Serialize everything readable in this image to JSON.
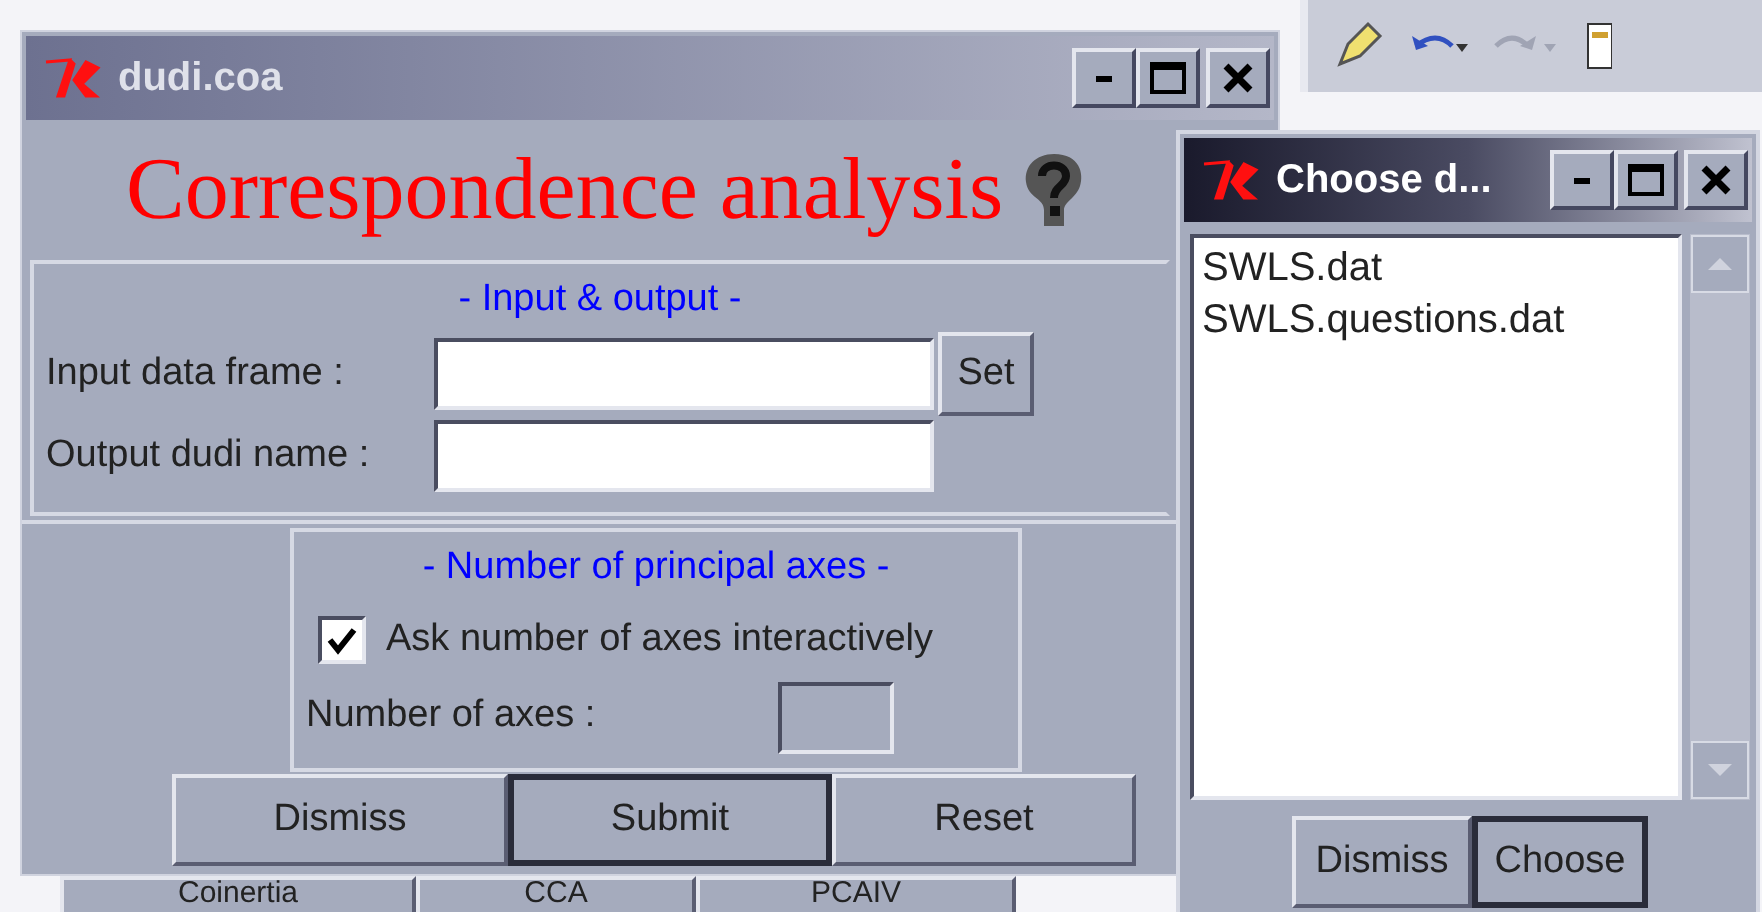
{
  "main_window": {
    "title": "dudi.coa",
    "heading": "Correspondence analysis",
    "input_output": {
      "legend": "- Input & output -",
      "fields": [
        {
          "label": "Input data frame :",
          "button": "Set"
        },
        {
          "label": "Output dudi name :"
        }
      ]
    },
    "axes": {
      "legend": "- Number of principal axes -",
      "checkbox": {
        "label": "Ask number of axes interactively",
        "checked": true
      },
      "field": {
        "label": "Number of axes :",
        "disabled": true
      }
    },
    "buttons": [
      {
        "label": "Dismiss",
        "default": false
      },
      {
        "label": "Submit",
        "default": true
      },
      {
        "label": "Reset",
        "default": false
      }
    ]
  },
  "tabs": [
    "Coinertia",
    "CCA",
    "PCAIV"
  ],
  "choose_window": {
    "title": "Choose d...",
    "items": [
      "SWLS.dat",
      "SWLS.questions.dat"
    ],
    "buttons": [
      {
        "label": "Dismiss",
        "default": false
      },
      {
        "label": "Choose",
        "default": true
      }
    ]
  }
}
